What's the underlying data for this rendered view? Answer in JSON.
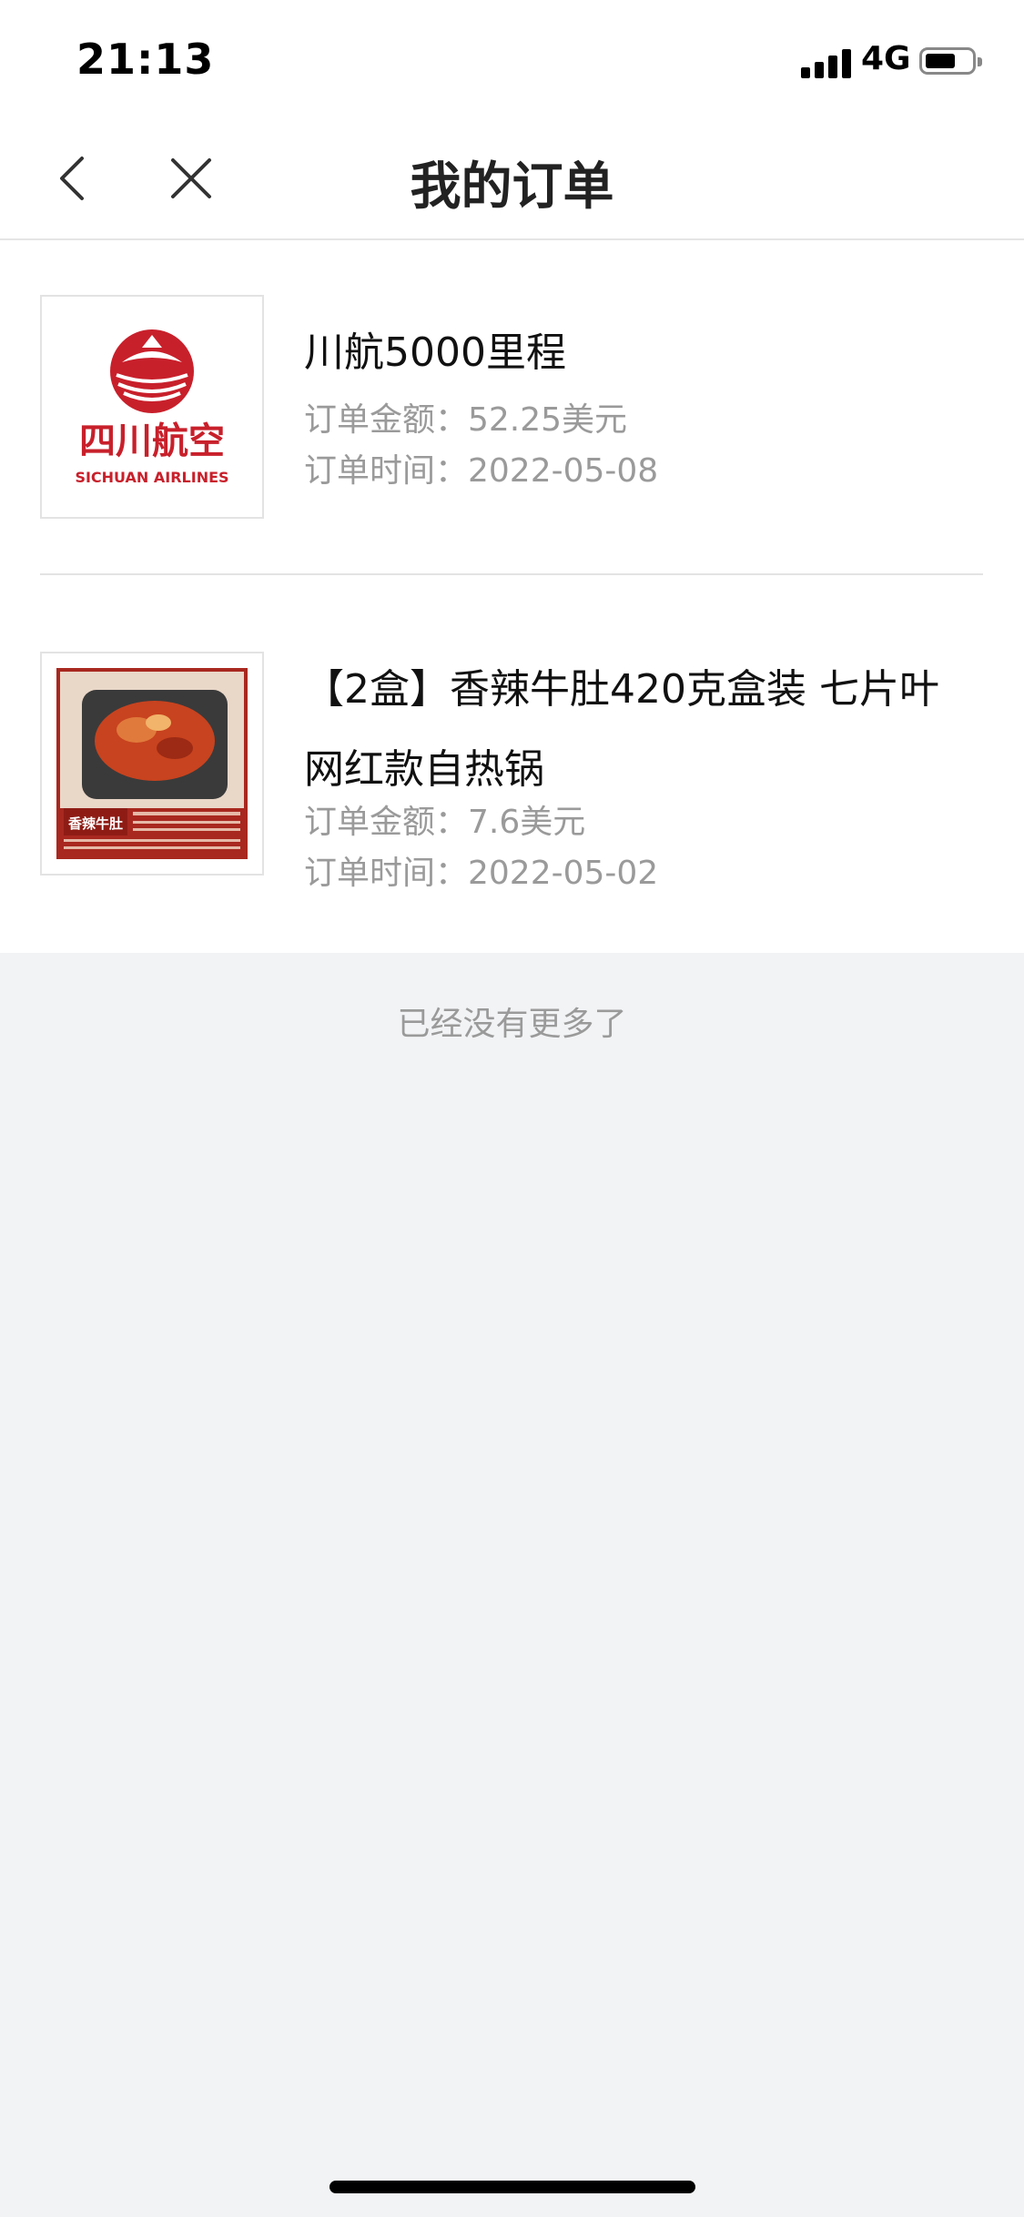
{
  "status_bar": {
    "time": "21:13",
    "network": "4G"
  },
  "nav": {
    "title": "我的订单"
  },
  "orders": [
    {
      "title": "川航5000里程",
      "amount_label": "订单金额：52.25美元",
      "time_label": "订单时间：2022-05-08",
      "logo_text_cn": "四川航空",
      "logo_text_en": "SICHUAN AIRLINES"
    },
    {
      "title_line1": "【2盒】香辣牛肚420克盒装 七片叶",
      "title_line2": "网红款自热锅",
      "amount_label": "订单金额：7.6美元",
      "time_label": "订单时间：2022-05-02",
      "image_label": "香辣牛肚"
    }
  ],
  "footer": {
    "end_text": "已经没有更多了"
  },
  "colors": {
    "brand_red": "#c8202b",
    "muted_text": "#9a9a9a"
  }
}
